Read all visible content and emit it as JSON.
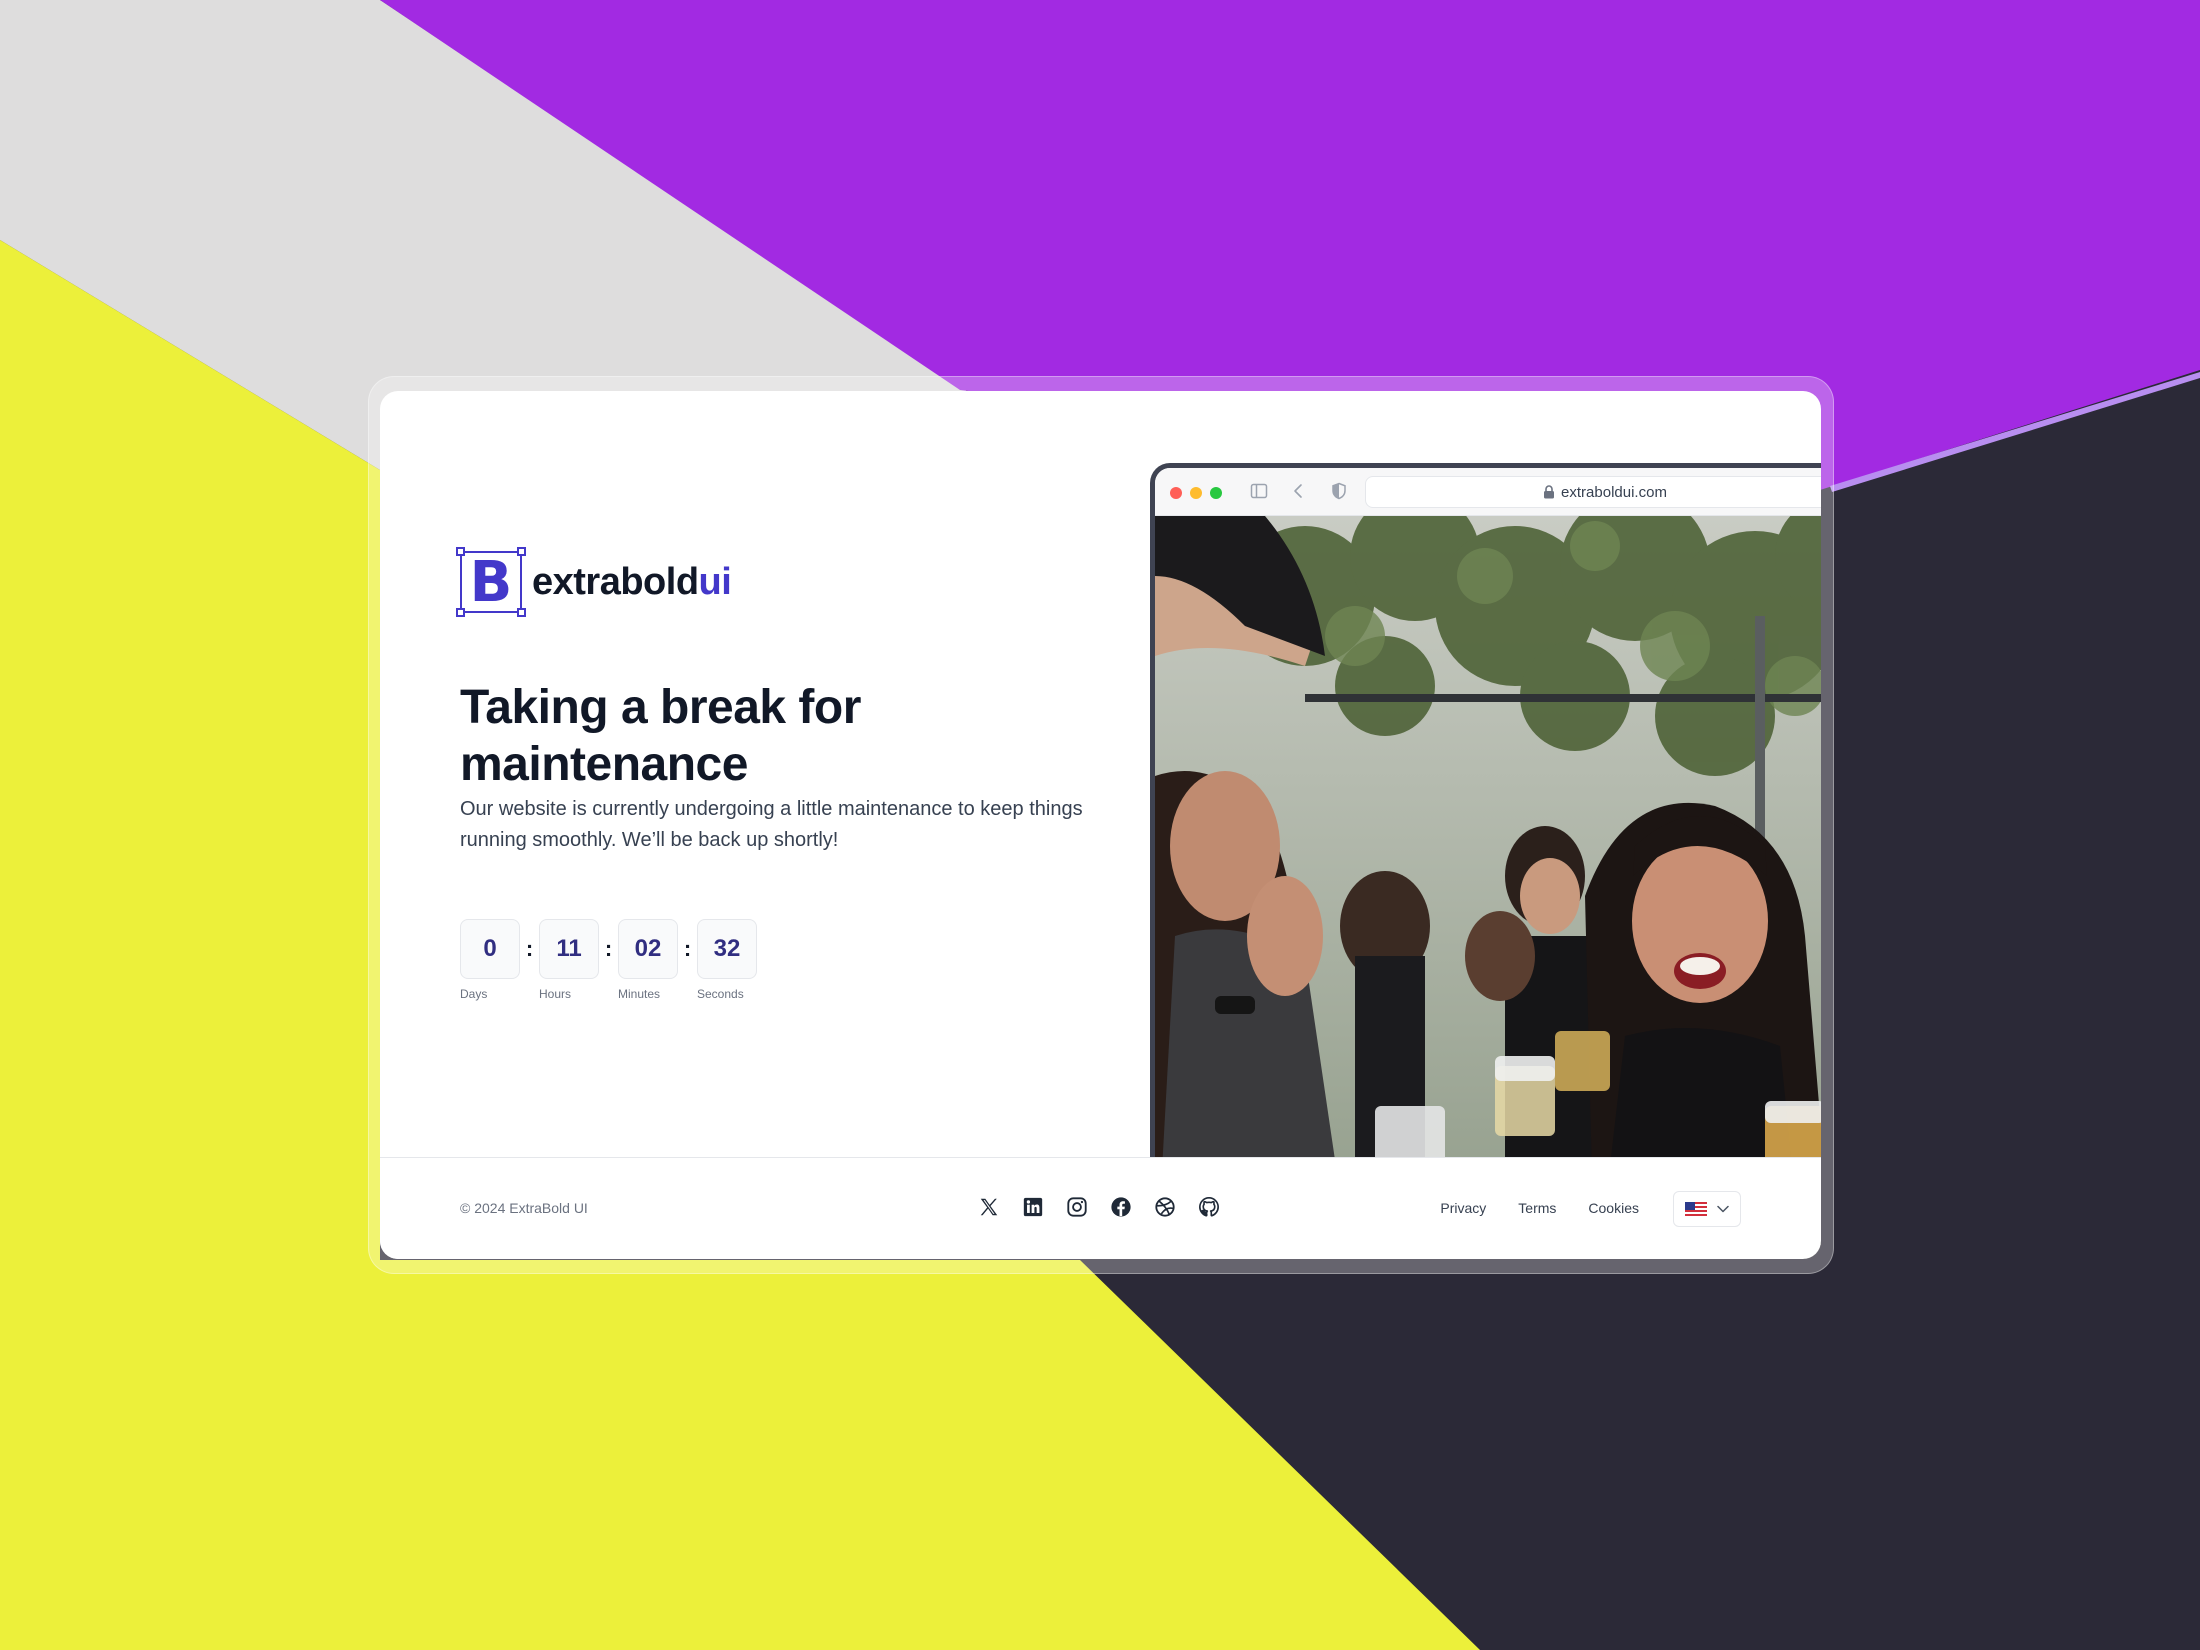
{
  "brand": {
    "logo_letter": "B",
    "name_main": "extrabold",
    "name_accent": "ui",
    "color": "#4338ca"
  },
  "hero": {
    "title": "Taking a break for maintenance",
    "description": "Our website is currently undergoing a little maintenance to keep things running smoothly. We’ll be back up shortly!"
  },
  "countdown": {
    "separator": ":",
    "units": [
      {
        "value": "0",
        "label": "Days"
      },
      {
        "value": "11",
        "label": "Hours"
      },
      {
        "value": "02",
        "label": "Minutes"
      },
      {
        "value": "32",
        "label": "Seconds"
      }
    ]
  },
  "browser": {
    "url": "extraboldui.com",
    "icons": [
      "sidebar-icon",
      "back-icon",
      "shield-icon",
      "lock-icon"
    ]
  },
  "footer": {
    "copyright": "© 2024 ExtraBold UI",
    "socials": [
      "x-icon",
      "linkedin-icon",
      "instagram-icon",
      "facebook-icon",
      "dribbble-icon",
      "github-icon"
    ],
    "links": {
      "privacy": "Privacy",
      "terms": "Terms",
      "cookies": "Cookies"
    },
    "language_icon": "us-flag-icon"
  },
  "colors": {
    "purple": "#a12ae0",
    "yellow": "#eef33a",
    "light_gray": "#dcdcdc",
    "dark": "#2a2836",
    "heading": "#111827"
  }
}
